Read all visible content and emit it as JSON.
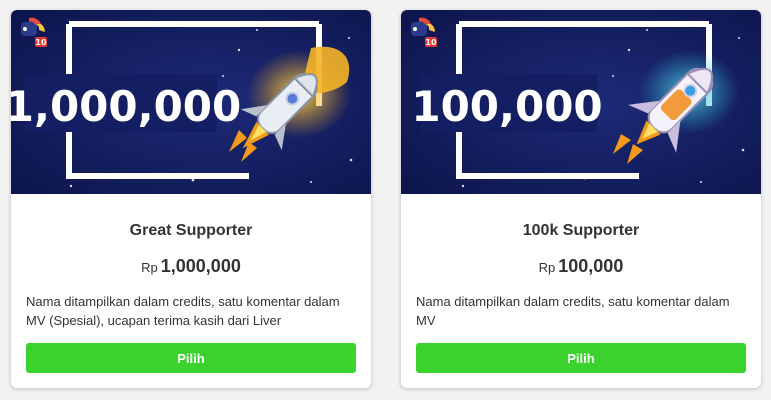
{
  "brand": {
    "color_button": "#3cd22d",
    "color_banner": "#121c5a"
  },
  "cards": [
    {
      "banner_amount": "1,000,000",
      "badge": "10",
      "title": "Great Supporter",
      "currency": "Rp",
      "price": "1,000,000",
      "description": "Nama ditampilkan dalam credits, satu komentar dalam MV (Spesial), ucapan terima kasih dari Liver",
      "button_label": "Pilih",
      "rocket_icon": "rocket-gold-icon"
    },
    {
      "banner_amount": "100,000",
      "badge": "10",
      "title": "100k Supporter",
      "currency": "Rp",
      "price": "100,000",
      "description": "Nama ditampilkan dalam credits, satu komentar dalam MV",
      "button_label": "Pilih",
      "rocket_icon": "rocket-orange-icon"
    }
  ]
}
